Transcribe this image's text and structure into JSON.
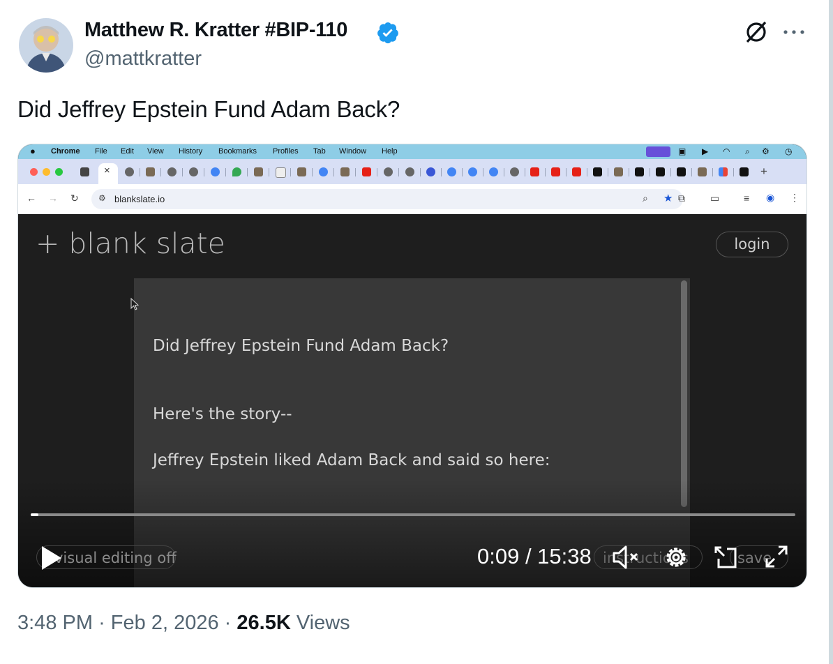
{
  "tweet": {
    "author_name": "Matthew R. Kratter #BIP-110",
    "handle": "@mattkratter",
    "text": "Did Jeffrey Epstein Fund Adam Back?",
    "time": "3:48 PM",
    "separator1": "·",
    "date": "Feb 2, 2026",
    "separator2": "·",
    "views_count": "26.5K",
    "views_label": "Views",
    "verified_color": "#1d9bf0"
  },
  "mac_menu": {
    "app": "Chrome",
    "items": [
      "File",
      "Edit",
      "View",
      "History",
      "Bookmarks",
      "Profiles",
      "Tab",
      "Window",
      "Help"
    ]
  },
  "browser": {
    "url": "blankslate.io",
    "active_tab_close": "×",
    "new_tab": "+"
  },
  "page": {
    "logo": "+ blank slate",
    "login": "login",
    "lines": [
      "Did Jeffrey Epstein Fund Adam Back?",
      "Here's the story--",
      "Jeffrey Epstein liked Adam Back and said so here:"
    ],
    "visual_editing": "visual editing off",
    "instructions": "instructions",
    "save": "save"
  },
  "video": {
    "time": "0:09 / 15:38",
    "progress": 0.0097
  }
}
